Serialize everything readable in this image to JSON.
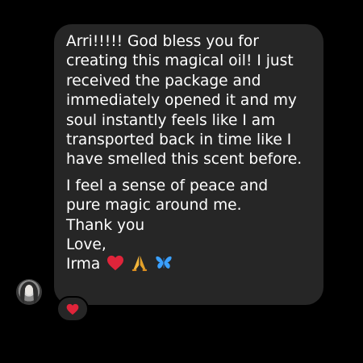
{
  "message": {
    "para1": [
      "Arri!!!!! God bless you for",
      "creating this magical oil! I just",
      "received the package and",
      "immediately opened it and my",
      "soul instantly feels like I am",
      "transported back in time like I",
      "have smelled this scent before."
    ],
    "para2": [
      "I feel a sense of peace and",
      "pure magic around me.",
      "Thank you",
      "Love,"
    ],
    "signature": "Irma",
    "signature_emojis": [
      "red-heart",
      "folded-hands",
      "blue-butterfly"
    ]
  },
  "reaction": {
    "emoji": "red-heart"
  },
  "colors": {
    "background": "#000000",
    "bubble": "#262626",
    "text": "#ffffff",
    "heart": "#e0243a",
    "hands": "#f2b53b",
    "butterfly": "#3aa0ff"
  }
}
